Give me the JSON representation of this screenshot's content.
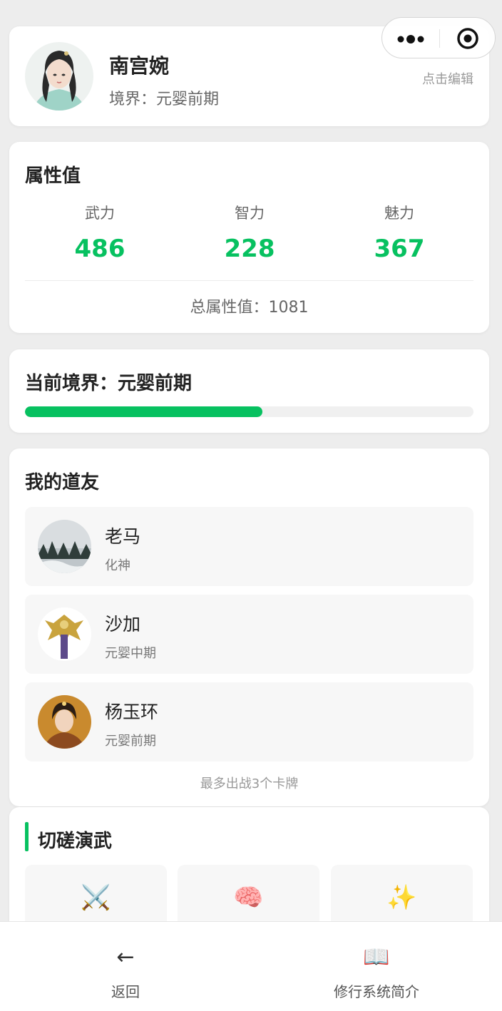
{
  "profile": {
    "name": "南宫婉",
    "realm_text": "境界：元婴前期",
    "edit_label": "点击编辑",
    "avatar": "portrait-woman-teal-robe"
  },
  "capsule": {
    "menu_icon": "more-dots-icon",
    "close_icon": "target-circle-icon"
  },
  "attributes": {
    "title": "属性值",
    "items": [
      {
        "label": "武力",
        "value": "486"
      },
      {
        "label": "智力",
        "value": "228"
      },
      {
        "label": "魅力",
        "value": "367"
      }
    ],
    "total_text": "总属性值：1081"
  },
  "realm": {
    "title": "当前境界：元婴前期",
    "progress": 0.53
  },
  "friends": {
    "title": "我的道友",
    "items": [
      {
        "name": "老马",
        "realm": "化神",
        "avatar": "landscape-snow-forest"
      },
      {
        "name": "沙加",
        "realm": "元婴中期",
        "avatar": "golden-armored-figure"
      },
      {
        "name": "杨玉环",
        "realm": "元婴前期",
        "avatar": "portrait-woman-tang-dress"
      }
    ],
    "note": "最多出战3个卡牌"
  },
  "spar": {
    "title": "切磋演武",
    "items": [
      {
        "icon": "crossed-swords-icon",
        "glyph": "⚔️"
      },
      {
        "icon": "brain-icon",
        "glyph": "🧠"
      },
      {
        "icon": "sparkles-icon",
        "glyph": "✨"
      }
    ]
  },
  "tabbar": {
    "items": [
      {
        "label": "返回",
        "icon": "back-arrow-icon",
        "glyph": "←"
      },
      {
        "label": "修行系统简介",
        "icon": "open-book-icon",
        "glyph": "📖"
      }
    ]
  },
  "colors": {
    "accent": "#07c160",
    "background": "#ededed",
    "card": "#ffffff"
  }
}
